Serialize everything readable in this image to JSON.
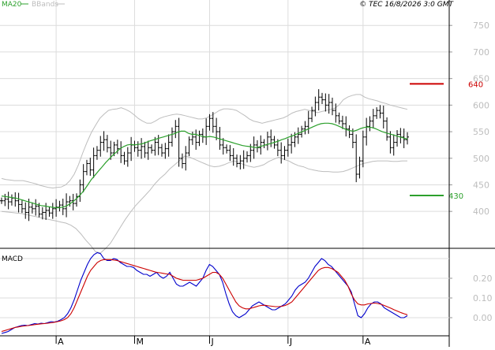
{
  "header": {
    "legend_ma": "MA20",
    "legend_bb": "BBands",
    "copyright": "© TEC 16/8/2026 3:0 GMT"
  },
  "chart_data": [
    {
      "type": "ohlc",
      "title": "",
      "ylim": [
        335,
        780
      ],
      "y_ticks": [
        "750",
        "700",
        "650",
        "600",
        "550",
        "500",
        "450",
        "400"
      ],
      "x_ticks": [
        "A",
        "M",
        "J",
        "J",
        "A"
      ],
      "colors": {
        "bars": "#000000",
        "ma": "#2ca02c",
        "bbands": "#bdbdbd",
        "resistance": "#cc0000",
        "support": "#2ca02c"
      },
      "levels": [
        {
          "label": "640",
          "value": 640,
          "color": "#cc0000"
        },
        {
          "label": "430",
          "value": 430,
          "color": "#2ca02c"
        }
      ],
      "series": [
        {
          "name": "close",
          "values": [
            420,
            423,
            418,
            425,
            420,
            413,
            405,
            398,
            408,
            405,
            410,
            395,
            398,
            402,
            397,
            405,
            408,
            412,
            405,
            418,
            420,
            415,
            428,
            450,
            475,
            490,
            478,
            505,
            515,
            530,
            535,
            520,
            510,
            525,
            518,
            505,
            495,
            510,
            525,
            520,
            515,
            522,
            510,
            520,
            515,
            530,
            520,
            510,
            518,
            530,
            550,
            560,
            500,
            490,
            510,
            535,
            540,
            530,
            545,
            540,
            560,
            575,
            560,
            550,
            525,
            520,
            515,
            505,
            500,
            490,
            495,
            500,
            505,
            515,
            525,
            520,
            530,
            525,
            540,
            535,
            525,
            515,
            505,
            515,
            525,
            530,
            540,
            545,
            555,
            560,
            575,
            590,
            605,
            615,
            610,
            600,
            605,
            590,
            580,
            570,
            565,
            555,
            545,
            530,
            470,
            495,
            540,
            560,
            570,
            580,
            590,
            585,
            570,
            540,
            520,
            530,
            545,
            540,
            535,
            540
          ]
        },
        {
          "name": "MA20",
          "values": [
            429,
            428,
            427,
            426,
            425,
            423,
            421,
            419,
            417,
            415,
            413,
            411,
            410,
            409,
            408,
            407,
            407,
            408,
            410,
            414,
            419,
            425,
            432,
            440,
            450,
            460,
            468,
            476,
            484,
            492,
            499,
            506,
            512,
            518,
            522,
            525,
            526,
            525,
            526,
            527,
            529,
            532,
            534,
            536,
            538,
            540,
            542,
            544,
            546,
            549,
            551,
            551,
            547,
            545,
            545,
            543,
            541,
            540,
            541,
            540,
            538,
            536,
            534,
            532,
            530,
            528,
            526,
            524,
            523,
            522,
            521,
            520,
            522,
            524,
            526,
            528,
            530,
            532,
            535,
            537,
            540,
            542,
            545,
            548,
            551,
            554,
            557,
            560,
            563,
            565,
            566,
            566,
            565,
            563,
            560,
            557,
            554,
            552,
            551,
            553,
            556,
            558,
            559,
            558,
            556,
            553,
            550,
            548,
            546,
            544,
            542,
            540,
            538,
            536
          ]
        },
        {
          "name": "BBand upper",
          "values": [
            462,
            460,
            459,
            458,
            458,
            458,
            456,
            454,
            452,
            449,
            447,
            445,
            444,
            445,
            446,
            450,
            458,
            470,
            488,
            510,
            530,
            548,
            562,
            575,
            583,
            590,
            592,
            593,
            595,
            592,
            588,
            582,
            575,
            570,
            566,
            566,
            570,
            575,
            578,
            580,
            582,
            583,
            582,
            580,
            578,
            576,
            574,
            574,
            576,
            580,
            585,
            590,
            593,
            593,
            592,
            590,
            585,
            580,
            574,
            570,
            568,
            566,
            568,
            570,
            572,
            574,
            576,
            580,
            585,
            588,
            590,
            592,
            590,
            588,
            586,
            588,
            590,
            592,
            594,
            600,
            610,
            615,
            618,
            620,
            620,
            615,
            612,
            610,
            608,
            605,
            603,
            600,
            598,
            596,
            594,
            592
          ]
        },
        {
          "name": "BBand lower",
          "values": [
            400,
            399,
            398,
            397,
            396,
            394,
            392,
            390,
            388,
            386,
            384,
            382,
            380,
            378,
            374,
            368,
            358,
            346,
            336,
            324,
            322,
            330,
            340,
            355,
            370,
            385,
            398,
            410,
            420,
            430,
            440,
            452,
            462,
            470,
            480,
            488,
            496,
            504,
            502,
            498,
            494,
            490,
            486,
            484,
            485,
            488,
            492,
            495,
            492,
            488,
            485,
            483,
            485,
            488,
            494,
            498,
            502,
            498,
            495,
            490,
            486,
            484,
            480,
            478,
            476,
            475,
            475,
            474,
            474,
            475,
            478,
            482,
            486,
            490,
            492,
            494,
            495,
            495,
            495,
            494,
            494,
            495,
            495
          ]
        }
      ]
    },
    {
      "type": "line",
      "title": "MACD",
      "ylim": [
        -0.08,
        0.34
      ],
      "y_ticks": [
        "0.20",
        "0.10",
        "0.00"
      ],
      "series": [
        {
          "name": "MACD",
          "color": "#0000cc",
          "values": [
            -0.08,
            -0.075,
            -0.07,
            -0.06,
            -0.05,
            -0.045,
            -0.04,
            -0.038,
            -0.04,
            -0.035,
            -0.03,
            -0.032,
            -0.028,
            -0.03,
            -0.025,
            -0.02,
            -0.022,
            -0.018,
            -0.01,
            0.0,
            0.02,
            0.05,
            0.09,
            0.14,
            0.19,
            0.23,
            0.27,
            0.3,
            0.32,
            0.33,
            0.325,
            0.3,
            0.29,
            0.29,
            0.3,
            0.295,
            0.28,
            0.27,
            0.26,
            0.26,
            0.255,
            0.24,
            0.23,
            0.22,
            0.22,
            0.21,
            0.22,
            0.23,
            0.21,
            0.2,
            0.21,
            0.23,
            0.2,
            0.17,
            0.16,
            0.16,
            0.17,
            0.18,
            0.17,
            0.16,
            0.18,
            0.2,
            0.24,
            0.27,
            0.26,
            0.24,
            0.22,
            0.18,
            0.12,
            0.07,
            0.03,
            0.01,
            0.0,
            0.01,
            0.02,
            0.04,
            0.06,
            0.07,
            0.08,
            0.07,
            0.06,
            0.05,
            0.04,
            0.04,
            0.05,
            0.06,
            0.07,
            0.09,
            0.11,
            0.14,
            0.16,
            0.17,
            0.18,
            0.2,
            0.23,
            0.26,
            0.28,
            0.3,
            0.29,
            0.27,
            0.26,
            0.24,
            0.22,
            0.2,
            0.18,
            0.16,
            0.13,
            0.07,
            0.01,
            0.0,
            0.02,
            0.05,
            0.07,
            0.08,
            0.08,
            0.07,
            0.05,
            0.04,
            0.03,
            0.02,
            0.01,
            0.0,
            0.0,
            0.01
          ]
        },
        {
          "name": "Signal",
          "color": "#cc0000",
          "values": [
            -0.07,
            -0.065,
            -0.06,
            -0.055,
            -0.05,
            -0.047,
            -0.044,
            -0.042,
            -0.04,
            -0.038,
            -0.035,
            -0.033,
            -0.031,
            -0.03,
            -0.028,
            -0.026,
            -0.023,
            -0.02,
            -0.016,
            -0.01,
            0.0,
            0.02,
            0.05,
            0.09,
            0.13,
            0.17,
            0.21,
            0.24,
            0.26,
            0.28,
            0.29,
            0.295,
            0.295,
            0.295,
            0.293,
            0.29,
            0.285,
            0.28,
            0.275,
            0.27,
            0.265,
            0.26,
            0.255,
            0.25,
            0.245,
            0.24,
            0.235,
            0.23,
            0.228,
            0.225,
            0.222,
            0.22,
            0.21,
            0.2,
            0.195,
            0.19,
            0.19,
            0.19,
            0.19,
            0.19,
            0.195,
            0.2,
            0.21,
            0.22,
            0.23,
            0.23,
            0.22,
            0.2,
            0.17,
            0.14,
            0.11,
            0.08,
            0.06,
            0.05,
            0.045,
            0.045,
            0.05,
            0.055,
            0.06,
            0.063,
            0.063,
            0.06,
            0.058,
            0.056,
            0.056,
            0.058,
            0.062,
            0.07,
            0.08,
            0.1,
            0.12,
            0.14,
            0.16,
            0.18,
            0.2,
            0.22,
            0.24,
            0.25,
            0.255,
            0.255,
            0.25,
            0.24,
            0.23,
            0.21,
            0.19,
            0.16,
            0.12,
            0.09,
            0.07,
            0.065,
            0.065,
            0.07,
            0.072,
            0.074,
            0.072,
            0.068,
            0.062,
            0.055,
            0.048,
            0.04,
            0.033,
            0.026,
            0.02,
            0.015
          ]
        }
      ]
    }
  ]
}
